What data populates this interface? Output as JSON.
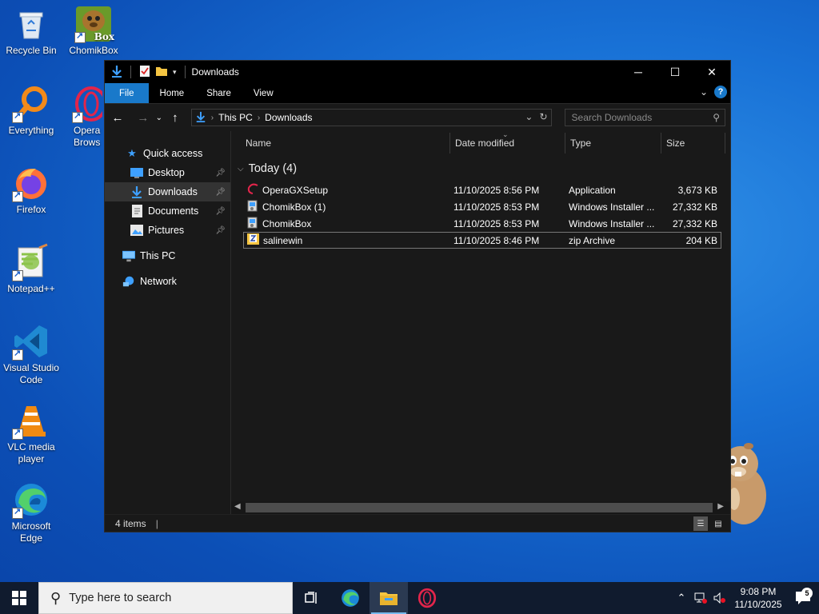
{
  "desktop": {
    "icons": [
      {
        "label": "Recycle Bin"
      },
      {
        "label": "ChomikBox"
      },
      {
        "label": "Everything"
      },
      {
        "label": "Opera GX Browser",
        "visible_label": "Opera G\nBrows"
      },
      {
        "label": "Firefox"
      },
      {
        "label": "Notepad++"
      },
      {
        "label": "Visual Studio Code"
      },
      {
        "label": "VLC media player"
      },
      {
        "label": "Microsoft Edge"
      }
    ],
    "chomikbox_badge": "Box"
  },
  "window": {
    "title": "Downloads",
    "ribbon_tabs": [
      "File",
      "Home",
      "Share",
      "View"
    ],
    "help_label": "?",
    "address": {
      "crumbs": [
        "This PC",
        "Downloads"
      ]
    },
    "search": {
      "placeholder": "Search Downloads"
    },
    "nav": {
      "quick_access": "Quick access",
      "items": [
        "Desktop",
        "Downloads",
        "Documents",
        "Pictures"
      ],
      "this_pc": "This PC",
      "network": "Network"
    },
    "columns": [
      "Name",
      "Date modified",
      "Type",
      "Size"
    ],
    "group": "Today (4)",
    "files": [
      {
        "name": "OperaGXSetup",
        "date": "11/10/2025 8:56 PM",
        "type": "Application",
        "size": "3,673 KB",
        "icon": "opera-icon"
      },
      {
        "name": "ChomikBox (1)",
        "date": "11/10/2025 8:53 PM",
        "type": "Windows Installer ...",
        "size": "27,332 KB",
        "icon": "installer-icon"
      },
      {
        "name": "ChomikBox",
        "date": "11/10/2025 8:53 PM",
        "type": "Windows Installer ...",
        "size": "27,332 KB",
        "icon": "installer-icon"
      },
      {
        "name": "salinewin",
        "date": "11/10/2025 8:46 PM",
        "type": "zip Archive",
        "size": "204 KB",
        "icon": "zip-icon"
      }
    ],
    "status": "4 items"
  },
  "taskbar": {
    "search_placeholder": "Type here to search",
    "time": "9:08 PM",
    "date": "11/10/2025",
    "notifications": "5"
  },
  "colors": {
    "accent": "#1979ca",
    "window_bg": "#191919",
    "taskbar": "#101b2e"
  }
}
